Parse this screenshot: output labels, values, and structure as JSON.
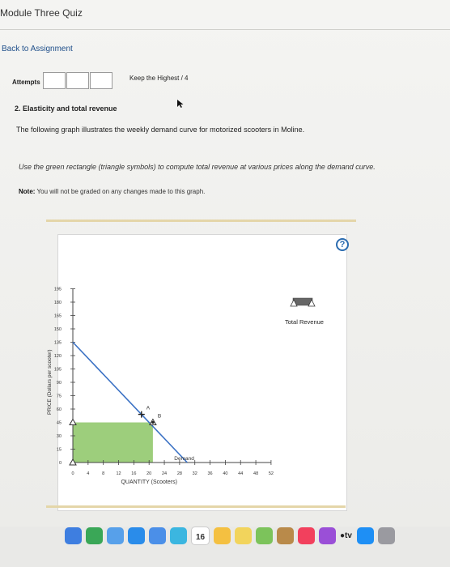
{
  "header": {
    "title": "Module Three Quiz"
  },
  "nav": {
    "back_label": "Back to Assignment"
  },
  "attempts": {
    "label": "Attempts",
    "keep": "Keep the Highest / 4"
  },
  "question": {
    "title": "2. Elasticity and total revenue",
    "text": "The following graph illustrates the weekly demand curve for motorized scooters in Moline.",
    "instructions": "Use the green rectangle (triangle symbols) to compute total revenue at various prices along the demand curve.",
    "note_label": "Note:",
    "note_text": " You will not be graded on any changes made to this graph."
  },
  "graph": {
    "help": "?"
  },
  "chart_data": {
    "type": "line",
    "xlabel": "QUANTITY (Scooters)",
    "ylabel": "PRICE (Dollars per scooter)",
    "x_ticks": [
      0,
      4,
      8,
      12,
      16,
      20,
      24,
      28,
      32,
      36,
      40,
      44,
      48,
      52
    ],
    "y_ticks": [
      0,
      15,
      30,
      45,
      60,
      75,
      90,
      105,
      120,
      135,
      150,
      165,
      180,
      195
    ],
    "xlim": [
      0,
      52
    ],
    "ylim": [
      0,
      195
    ],
    "series": [
      {
        "name": "Demand",
        "points": [
          [
            0,
            135
          ],
          [
            30,
            0
          ]
        ]
      }
    ],
    "points": [
      {
        "label": "A",
        "x": 18,
        "y": 54
      },
      {
        "label": "B",
        "x": 21,
        "y": 45
      }
    ],
    "rectangle": {
      "x0": 0,
      "x1": 21,
      "y0": 0,
      "y1": 45,
      "color": "#8cc665"
    },
    "legend": {
      "label": "Total Revenue",
      "position": "right"
    }
  },
  "dock": {
    "calendar_day": "16",
    "tv_label": "tv",
    "icons": [
      "facetime-icon",
      "chrome-icon",
      "finder-icon",
      "safari-icon",
      "mail-icon",
      "notes-icon",
      "calendar-icon",
      "photos-icon",
      "notepad-icon",
      "game-icon",
      "preview-icon",
      "music-icon",
      "podcast-icon",
      "tv-icon",
      "appstore-icon",
      "settings-icon"
    ],
    "colors": {
      "facetime-icon": "#3e7ee0",
      "chrome-icon": "#3aa757",
      "finder-icon": "#57a0ea",
      "safari-icon": "#2a8cea",
      "mail-icon": "#4b8fe8",
      "notes-icon": "#3bb6e0",
      "calendar-icon": "#ffffff",
      "photos-icon": "#f4c041",
      "notepad-icon": "#f2d45c",
      "game-icon": "#7cc35b",
      "preview-icon": "#b98a4a",
      "music-icon": "#f2405d",
      "podcast-icon": "#9a4fd7",
      "tv-icon": "#1d1d1f",
      "appstore-icon": "#1e8ff5",
      "settings-icon": "#9a9aa0"
    }
  }
}
